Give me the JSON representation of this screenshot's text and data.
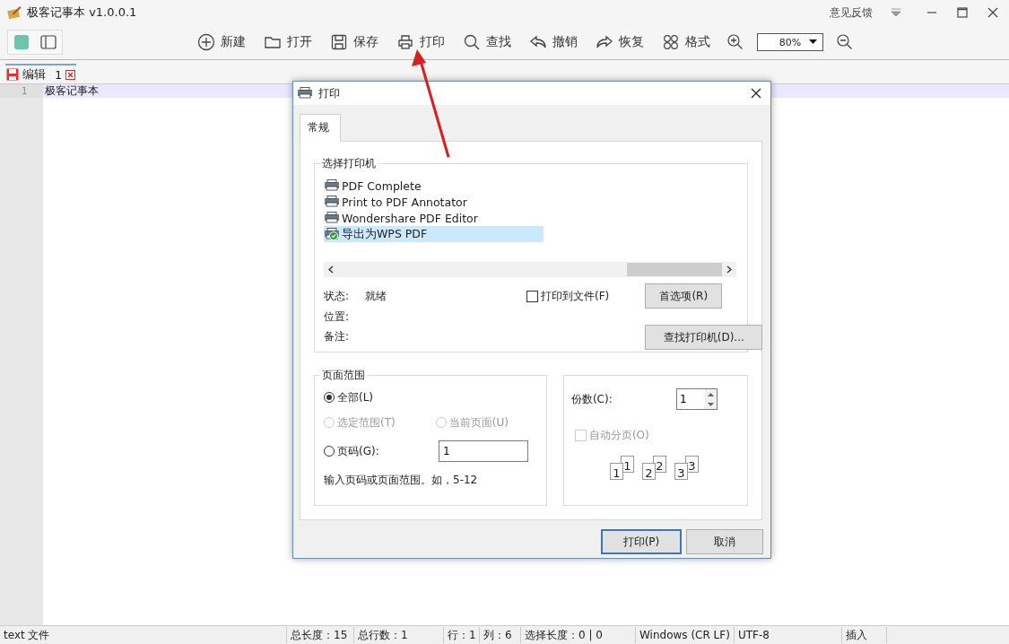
{
  "window": {
    "title": "极客记事本 v1.0.0.1",
    "feedback": "意见反馈"
  },
  "toolbar": {
    "buttons": [
      {
        "kind": "new",
        "label": "新建"
      },
      {
        "kind": "open",
        "label": "打开"
      },
      {
        "kind": "save",
        "label": "保存"
      },
      {
        "kind": "print",
        "label": "打印"
      },
      {
        "kind": "find",
        "label": "查找"
      },
      {
        "kind": "undo",
        "label": "撤销"
      },
      {
        "kind": "redo",
        "label": "恢复"
      },
      {
        "kind": "format",
        "label": "格式"
      }
    ],
    "zoom": "80%"
  },
  "tabs": [
    {
      "label": "编辑",
      "number": "1",
      "selected": true
    }
  ],
  "editor": {
    "lines": [
      {
        "number": "1",
        "text": "极客记事本",
        "current": true
      }
    ]
  },
  "dialog": {
    "title": "打印",
    "tabs": [
      {
        "label": "常规",
        "selected": true
      }
    ],
    "printer_group": "选择打印机",
    "printers": [
      {
        "name": "PDF Complete",
        "selected": false,
        "default": false
      },
      {
        "name": "Print to PDF Annotator",
        "selected": false,
        "default": false
      },
      {
        "name": "Wondershare PDF Editor",
        "selected": false,
        "default": false
      },
      {
        "name": "导出为WPS PDF",
        "selected": true,
        "default": true
      }
    ],
    "status_label": "状态:",
    "status_value": "就绪",
    "location_label": "位置:",
    "comment_label": "备注:",
    "print_to_file": {
      "label": "打印到文件(F)",
      "checked": false
    },
    "preferences_button": "首选项(R)",
    "find_printer_button": "查找打印机(D)...",
    "range_group": "页面范围",
    "range_options": [
      {
        "label": "全部(L)",
        "selected": true,
        "disabled": false
      },
      {
        "label": "选定范围(T)",
        "selected": false,
        "disabled": true
      },
      {
        "label": "当前页面(U)",
        "selected": false,
        "disabled": true
      },
      {
        "label": "页码(G):",
        "selected": false,
        "disabled": false
      }
    ],
    "pages_value": "1",
    "range_hint": "输入页码或页面范围。如，5-12",
    "copies_label": "份数(C):",
    "copies_value": "1",
    "collate": {
      "label": "自动分页(O)",
      "checked": false,
      "disabled": true
    },
    "collate_pages": [
      {
        "back": "1",
        "front": "1"
      },
      {
        "back": "2",
        "front": "2"
      },
      {
        "back": "3",
        "front": "3"
      }
    ],
    "print_button": "打印(P)",
    "cancel_button": "取消"
  },
  "status_bar": [
    "text 文件",
    "总长度：15",
    "总行数：1",
    "行：1",
    "列：6",
    "选择长度：0 | 0",
    "Windows (CR LF)",
    "UTF-8",
    "插入"
  ]
}
